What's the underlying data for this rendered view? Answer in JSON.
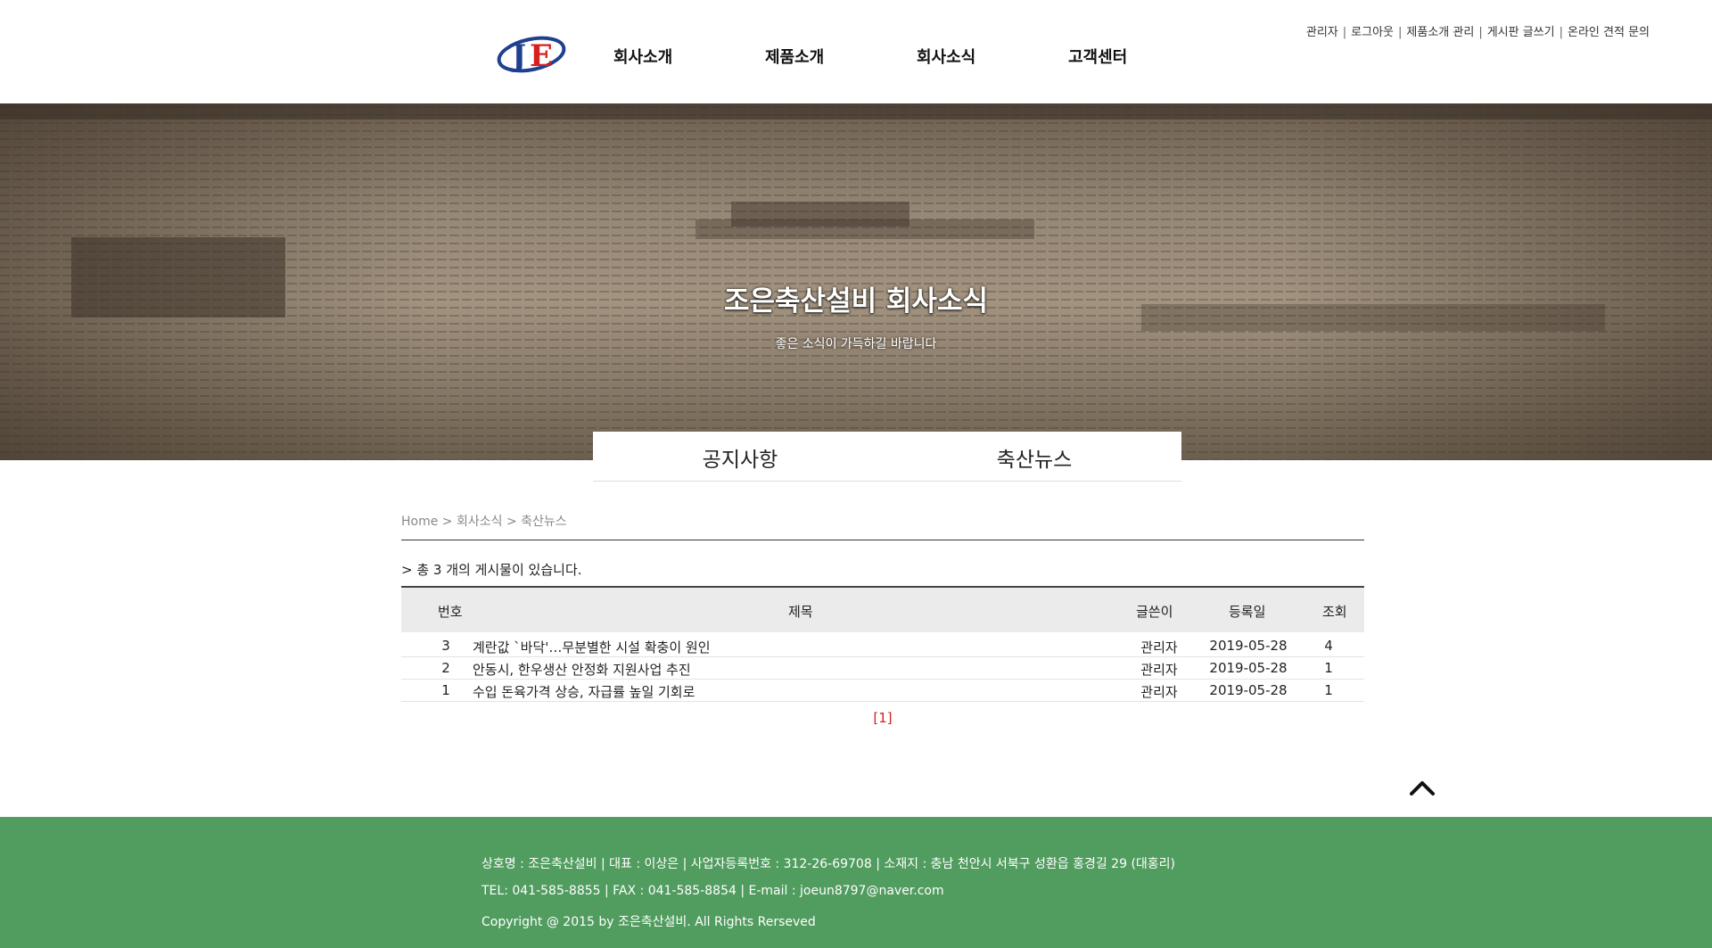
{
  "header": {
    "logo_text": "JE",
    "nav": [
      "회사소개",
      "제품소개",
      "회사소식",
      "고객센터"
    ],
    "util_links": [
      "관리자",
      "로그아웃",
      "제품소개 관리",
      "게시판 글쓰기",
      "온라인 견적 문의"
    ]
  },
  "hero": {
    "title": "조은축산설비 회사소식",
    "subtitle": "좋은 소식이 가득하길 바랍니다"
  },
  "subtabs": [
    "공지사항",
    "축산뉴스"
  ],
  "breadcrumb": "Home > 회사소식 > 축산뉴스",
  "board": {
    "total_text": "> 총 3 개의 게시물이 있습니다.",
    "headers": {
      "num": "번호",
      "title": "제목",
      "author": "글쓴이",
      "date": "등록일",
      "views": "조회"
    },
    "rows": [
      {
        "num": "3",
        "title": "계란값 `바닥'…무분별한 시설 확충이 원인",
        "author": "관리자",
        "date": "2019-05-28",
        "views": "4"
      },
      {
        "num": "2",
        "title": "안동시, 한우생산 안정화 지원사업 추진",
        "author": "관리자",
        "date": "2019-05-28",
        "views": "1"
      },
      {
        "num": "1",
        "title": "수입 돈육가격 상승, 자급률 높일 기회로",
        "author": "관리자",
        "date": "2019-05-28",
        "views": "1"
      }
    ],
    "paging": "[1]"
  },
  "footer": {
    "line1": "상호명 : 조은축산설비 | 대표 : 이상은 | 사업자등록번호 : 312-26-69708 | 소재지 : 충남 천안시 서북구 성환읍 홍경길 29 (대홍리)",
    "line2": "TEL: 041-585-8855 | FAX : 041-585-8854 | E-mail : joeun8797@naver.com",
    "line3": "Copyright @ 2015 by 조은축산설비. All Rights Rerseved"
  },
  "colors": {
    "footer_bg": "#519c5f",
    "paging_active": "#d42020",
    "logo_blue": "#1f3f8f",
    "logo_red": "#d42020"
  },
  "icons": {
    "logo": "je-logo",
    "to_top": "chevron-up-icon"
  }
}
